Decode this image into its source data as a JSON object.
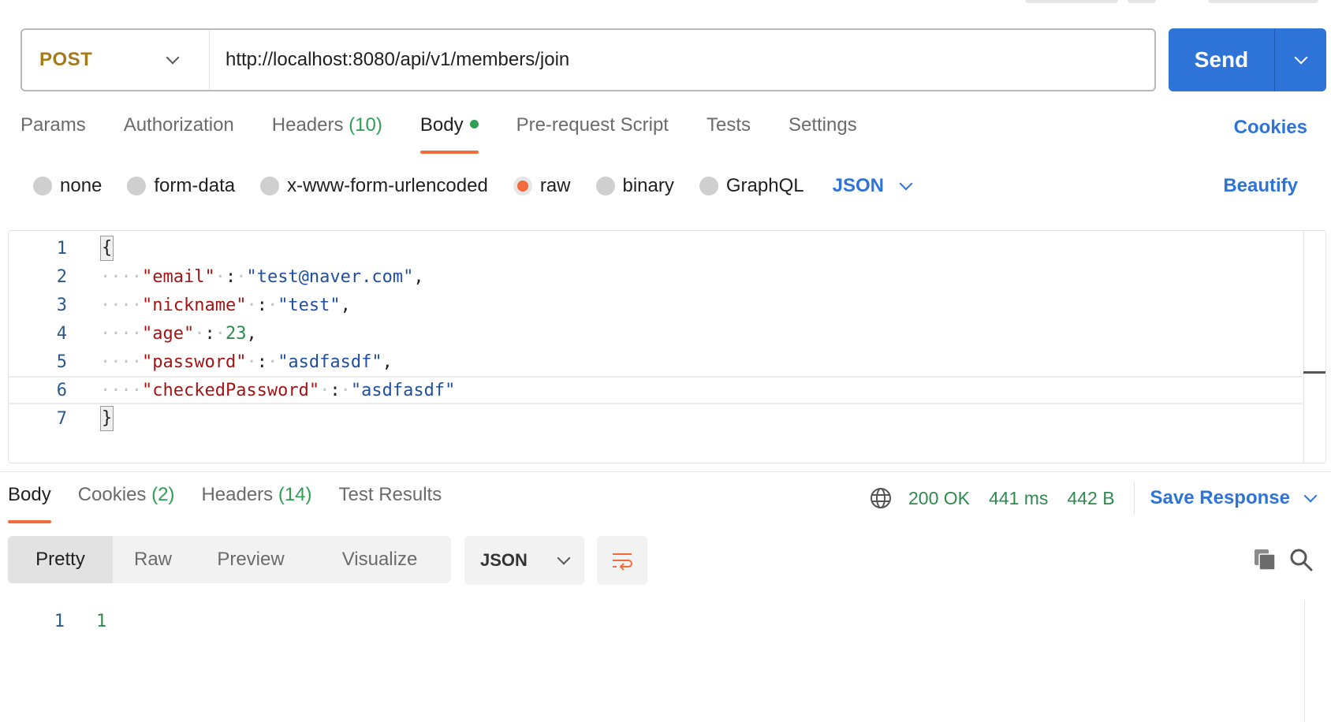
{
  "request": {
    "method": "POST",
    "url": "http://localhost:8080/api/v1/members/join",
    "send_label": "Send"
  },
  "request_tabs": [
    {
      "label": "Params"
    },
    {
      "label": "Authorization"
    },
    {
      "label": "Headers",
      "count": "(10)"
    },
    {
      "label": "Body"
    },
    {
      "label": "Pre-request Script"
    },
    {
      "label": "Tests"
    },
    {
      "label": "Settings"
    }
  ],
  "cookies_label": "Cookies",
  "body_types": {
    "options": [
      "none",
      "form-data",
      "x-www-form-urlencoded",
      "raw",
      "binary",
      "GraphQL"
    ],
    "selected": "raw",
    "language": "JSON",
    "beautify_label": "Beautify"
  },
  "editor": {
    "line_numbers": [
      "1",
      "2",
      "3",
      "4",
      "5",
      "6",
      "7"
    ],
    "open_brace": "{",
    "close_brace": "}",
    "fields": [
      {
        "key": "\"email\"",
        "value": "\"test@naver.com\"",
        "trail": ","
      },
      {
        "key": "\"nickname\"",
        "value": "\"test\"",
        "trail": ","
      },
      {
        "key": "\"age\"",
        "value": "23",
        "trail": ","
      },
      {
        "key": "\"password\"",
        "value": "\"asdfasdf\"",
        "trail": ","
      },
      {
        "key": "\"checkedPassword\"",
        "value": "\"asdfasdf\"",
        "trail": ""
      }
    ]
  },
  "response": {
    "tabs": [
      {
        "label": "Body"
      },
      {
        "label": "Cookies",
        "count": "(2)"
      },
      {
        "label": "Headers",
        "count": "(14)"
      },
      {
        "label": "Test Results"
      }
    ],
    "status": "200 OK",
    "time": "441 ms",
    "size": "442 B",
    "save_label": "Save Response",
    "views": [
      "Pretty",
      "Raw",
      "Preview",
      "Visualize"
    ],
    "format": "JSON",
    "line_number": "1",
    "body_value": "1"
  },
  "colors": {
    "accent": "#2e73d8",
    "method": "#a57a1a",
    "active_tab": "#f26b3a",
    "success": "#2f9e52"
  }
}
